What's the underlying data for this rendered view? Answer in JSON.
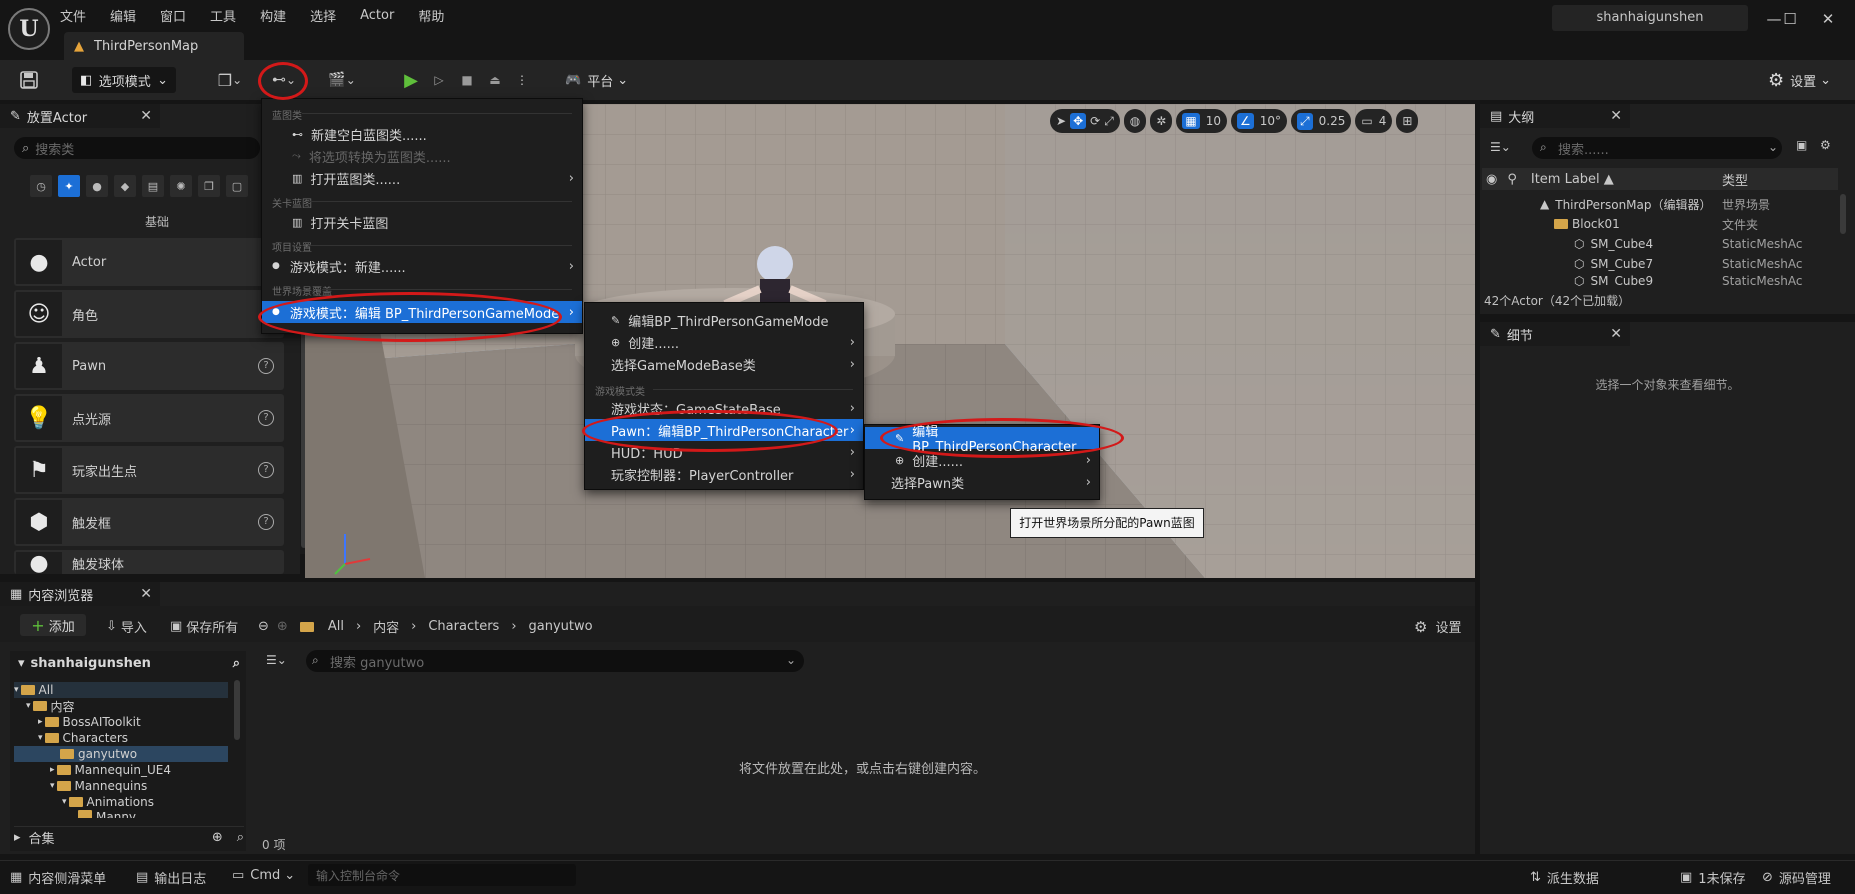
{
  "menubar": [
    "文件",
    "编辑",
    "窗口",
    "工具",
    "构建",
    "选择",
    "Actor",
    "帮助"
  ],
  "map_tab": "ThirdPersonMap",
  "user": "shanhaigunshen",
  "window_controls": {
    "minimize": "—",
    "maximize": "☐",
    "close": "✕"
  },
  "toolbar": {
    "mode_label": "选项模式",
    "platform_label": "平台",
    "settings_label": "设置"
  },
  "place_actor": {
    "title": "放置Actor",
    "search_placeholder": "搜索类",
    "category_label": "基础",
    "items": [
      {
        "label": "Actor",
        "icon": "sphere-icon"
      },
      {
        "label": "角色",
        "icon": "character-icon"
      },
      {
        "label": "Pawn",
        "icon": "pawn-icon"
      },
      {
        "label": "点光源",
        "icon": "light-icon"
      },
      {
        "label": "玩家出生点",
        "icon": "player-start-icon"
      },
      {
        "label": "触发框",
        "icon": "cube-icon"
      },
      {
        "label": "触发球体",
        "icon": "sphere-icon"
      }
    ]
  },
  "viewport": {
    "grid_snap": "10",
    "rot_snap": "10°",
    "scale_snap": "0.25",
    "camera_speed": "4"
  },
  "outliner": {
    "title": "大纲",
    "search_placeholder": "搜索......",
    "col_label": "Item Label ▲",
    "col_type": "类型",
    "rows": [
      {
        "label": "ThirdPersonMap（编辑器）",
        "type": "世界场景"
      },
      {
        "label": "Block01",
        "type": "文件夹"
      },
      {
        "label": "SM_Cube4",
        "type": "StaticMeshAc"
      },
      {
        "label": "SM_Cube7",
        "type": "StaticMeshAc"
      },
      {
        "label": "SM_Cube9",
        "type": "StaticMeshAc"
      }
    ],
    "count": "42个Actor（42个已加载）"
  },
  "details": {
    "title": "细节",
    "hint": "选择一个对象来查看细节。"
  },
  "content_browser": {
    "title": "内容浏览器",
    "add": "添加",
    "import": "导入",
    "save_all": "保存所有",
    "path": [
      "All",
      "内容",
      "Characters",
      "ganyutwo"
    ],
    "settings": "设置",
    "tree_root": "shanhaigunshen",
    "tree": [
      "All",
      "内容",
      "BossAIToolkit",
      "Characters",
      "ganyutwo",
      "Mannequin_UE4",
      "Mannequins",
      "Animations",
      "Manny"
    ],
    "collections": "合集",
    "search_placeholder": "搜索 ganyutwo",
    "empty_hint": "将文件放置在此处，或点击右键创建内容。",
    "item_count": "0 项"
  },
  "statusbar": {
    "drawer": "内容侧滑菜单",
    "output_log": "输出日志",
    "cmd": "Cmd",
    "cmd_placeholder": "输入控制台命令",
    "derived_data": "派生数据",
    "unsaved": "1未保存",
    "source_control": "源码管理"
  },
  "blueprint_menu": {
    "sec1": "蓝图类",
    "new_blank": "新建空白蓝图类......",
    "convert": "将选项转换为蓝图类......",
    "open_bp": "打开蓝图类......",
    "sec2": "关卡蓝图",
    "open_level": "打开关卡蓝图",
    "sec3": "项目设置",
    "gm_new": "游戏模式：新建......",
    "sec4": "世界场景覆盖",
    "gm_edit": "游戏模式：编辑 BP_ThirdPersonGameMode"
  },
  "gamemode_menu": {
    "edit": "编辑BP_ThirdPersonGameMode",
    "create": "创建......",
    "select_base": "选择GameModeBase类",
    "sec": "游戏模式类",
    "state": "游戏状态：GameStateBase",
    "pawn": "Pawn：编辑BP_ThirdPersonCharacter",
    "hud": "HUD：HUD",
    "controller": "玩家控制器：PlayerController"
  },
  "pawn_menu": {
    "edit": "编辑BP_ThirdPersonCharacter",
    "create": "创建......",
    "select": "选择Pawn类"
  },
  "tooltip": "打开世界场景所分配的Pawn蓝图"
}
